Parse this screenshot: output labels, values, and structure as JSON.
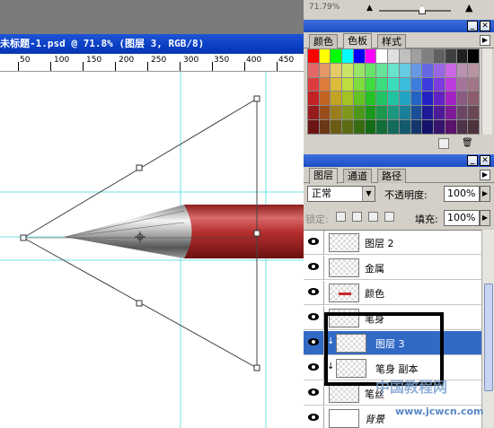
{
  "document": {
    "title": "未标题-1.psd @ 71.8% (图层 3, RGB/8)",
    "ruler_labels": [
      "50",
      "100",
      "150",
      "200",
      "250",
      "300",
      "350",
      "400",
      "450"
    ]
  },
  "navigator": {
    "zoom": "71.79%"
  },
  "color_panel": {
    "tabs": [
      "颜色",
      "色板",
      "样式"
    ],
    "active_tab": "色板"
  },
  "layers_panel": {
    "tabs": [
      "图层",
      "通道",
      "路径"
    ],
    "active_tab": "图层",
    "blend_mode": "正常",
    "opacity_label": "不透明度:",
    "opacity_value": "100%",
    "lock_label": "锁定:",
    "fill_label": "填充:",
    "fill_value": "100%",
    "layers": [
      {
        "name": "图层 2",
        "selected": false
      },
      {
        "name": "金属",
        "selected": false
      },
      {
        "name": "颜色",
        "selected": false
      },
      {
        "name": "笔身",
        "selected": false
      },
      {
        "name": "图层 3",
        "selected": true
      },
      {
        "name": "笔身 副本",
        "selected": false
      },
      {
        "name": "笔丝",
        "selected": false
      },
      {
        "name": "背景",
        "selected": false
      }
    ]
  },
  "watermark": {
    "text": "中国教程网",
    "url": "www.jcwcn.com"
  }
}
